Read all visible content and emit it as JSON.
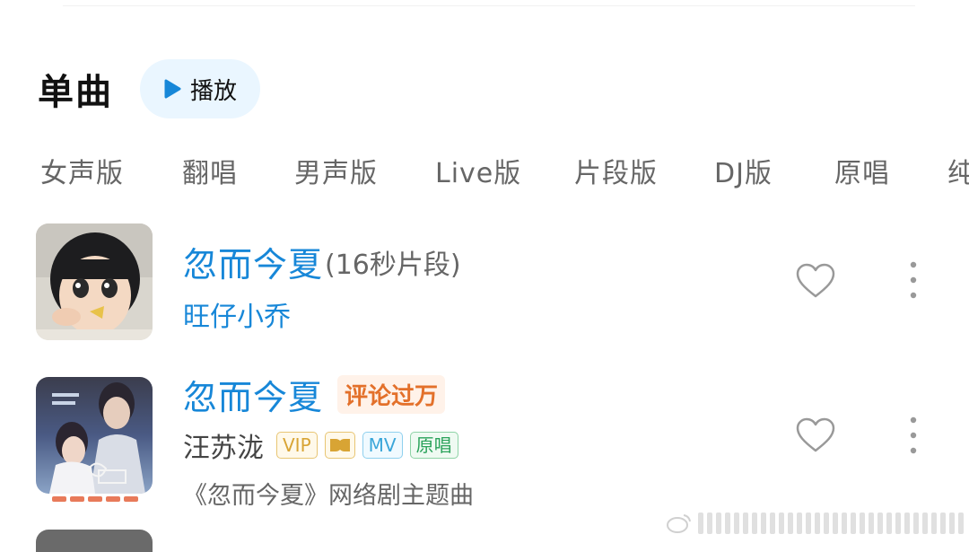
{
  "header": {
    "title": "单曲",
    "play_label": "播放",
    "accent": "#1787d8"
  },
  "tabs": [
    "女声版",
    "翻唱",
    "男声版",
    "Live版",
    "片段版",
    "DJ版",
    "原唱",
    "纯"
  ],
  "songs": [
    {
      "title": "忽而今夏",
      "title_suffix": "(16秒片段)",
      "artist": "旺仔小乔",
      "artist_color": "#1787d8"
    },
    {
      "title": "忽而今夏",
      "hot_tag": "评论过万",
      "artist": "汪苏泷",
      "artist_color": "#444444",
      "badges": {
        "vip": "VIP",
        "mv": "MV",
        "original": "原唱"
      },
      "description": "《忽而今夏》网络剧主题曲"
    }
  ],
  "icons": {
    "play": "play-triangle-icon",
    "like": "heart-outline-icon",
    "more": "vertical-dots-icon",
    "dolby": "dolby-icon"
  }
}
